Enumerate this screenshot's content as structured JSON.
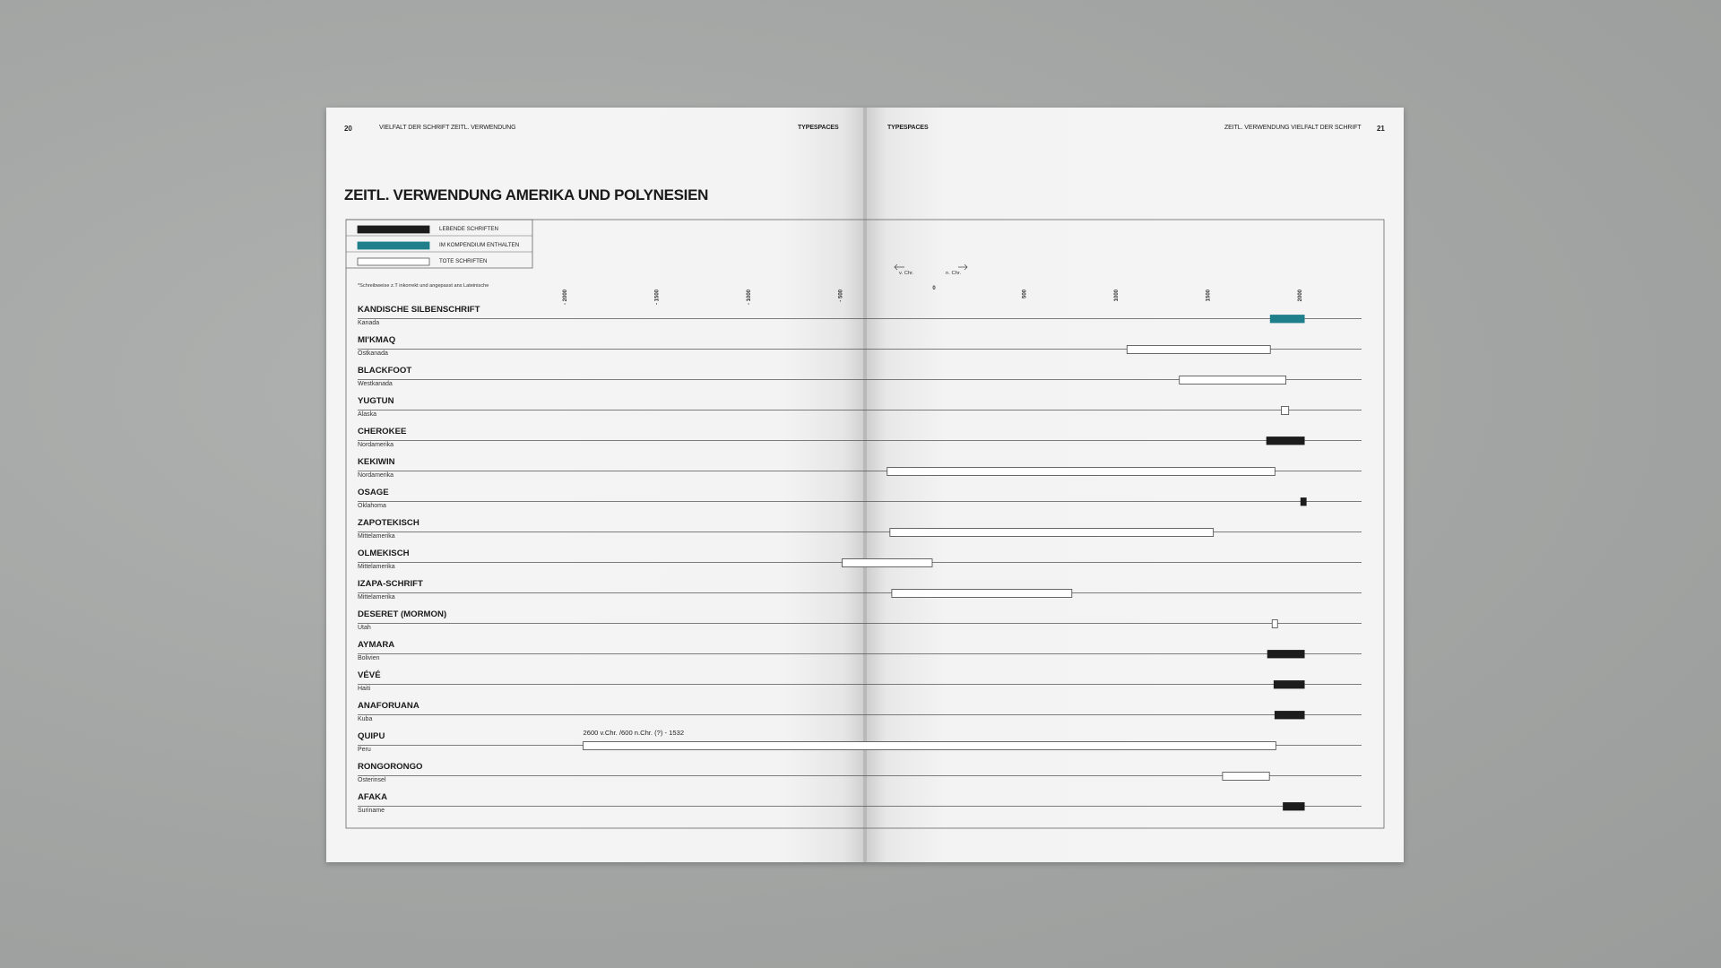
{
  "header": {
    "left_page_number": "20",
    "left_running_title": "VIELFALT DER SCHRIFT ZEITL. VERWENDUNG",
    "left_brand": "TYPESPACES",
    "right_brand": "TYPESPACES",
    "right_running_title": "ZEITL. VERWENDUNG VIELFALT DER SCHRIFT",
    "right_page_number": "21"
  },
  "page_title": "ZEITL. VERWENDUNG  AMERIKA UND POLYNESIEN",
  "colors": {
    "living": "#1c1c1c",
    "compendium": "#1f7f8a",
    "dead": "#ffffff",
    "rule": "#555555"
  },
  "chart_data": {
    "type": "timeline",
    "title": "ZEITL. VERWENDUNG  AMERIKA UND POLYNESIEN",
    "legend": [
      {
        "key": "living",
        "label": "LEBENDE SCHRIFTEN"
      },
      {
        "key": "compendium",
        "label": "IM KOMPENDIUM ENTHALTEN"
      },
      {
        "key": "dead",
        "label": "TOTE SCHRIFTEN"
      }
    ],
    "footnote": "*Schreibweise z.T inkorrekt und angepasst ans Lateinische",
    "era_labels": {
      "bc": "v. Chr.",
      "ad": "n. Chr."
    },
    "x_ticks": [
      {
        "value": -2000,
        "label": "- 2000"
      },
      {
        "value": -1500,
        "label": "- 1500"
      },
      {
        "value": -1000,
        "label": "- 1000"
      },
      {
        "value": -500,
        "label": "- 500"
      },
      {
        "value": 0,
        "label": "0"
      },
      {
        "value": 500,
        "label": "500"
      },
      {
        "value": 1000,
        "label": "1000"
      },
      {
        "value": 1500,
        "label": "1500"
      },
      {
        "value": 2000,
        "label": "2000"
      }
    ],
    "xlim": [
      -2000,
      2000
    ],
    "rows": [
      {
        "name": "KANDISCHE SILBENSCHRIFT",
        "region": "Kanada",
        "start": 1840,
        "end": 2025,
        "status": "compendium"
      },
      {
        "name": "MI'KMAQ",
        "region": "Ostkanada",
        "start": 1060,
        "end": 1840,
        "status": "dead"
      },
      {
        "name": "BLACKFOOT",
        "region": "Westkanada",
        "start": 1345,
        "end": 1925,
        "status": "dead"
      },
      {
        "name": "YUGTUN",
        "region": "Alaska",
        "start": 1900,
        "end": 1940,
        "status": "dead"
      },
      {
        "name": "CHEROKEE",
        "region": "Nordamerika",
        "start": 1820,
        "end": 2025,
        "status": "living"
      },
      {
        "name": "KEKIWIN",
        "region": "Nordamerika",
        "start": -245,
        "end": 1865,
        "status": "dead"
      },
      {
        "name": "OSAGE",
        "region": "Oklahoma",
        "start": 2006,
        "end": 2025,
        "status": "living"
      },
      {
        "name": "ZAPOTEKISCH",
        "region": "Mittelamerika",
        "start": -230,
        "end": 1530,
        "status": "dead"
      },
      {
        "name": "OLMEKISCH",
        "region": "Mittelamerika",
        "start": -490,
        "end": 0,
        "status": "dead"
      },
      {
        "name": "IZAPA-SCHRIFT",
        "region": "Mittelamerika",
        "start": -220,
        "end": 760,
        "status": "dead"
      },
      {
        "name": "DESERET (MORMON)",
        "region": "Utah",
        "start": 1850,
        "end": 1870,
        "status": "dead"
      },
      {
        "name": "AYMARA",
        "region": "Bolivien",
        "start": 1825,
        "end": 2025,
        "status": "living"
      },
      {
        "name": "VÉVÉ",
        "region": "Haiti",
        "start": 1860,
        "end": 2025,
        "status": "living"
      },
      {
        "name": "ANAFORUANA",
        "region": "Kuba",
        "start": 1865,
        "end": 2025,
        "status": "living"
      },
      {
        "name": "QUIPU",
        "region": "Peru",
        "start": -1900,
        "end": 1870,
        "status": "dead",
        "annotation": "2600 v.Chr. /600 n.Chr. (?) - 1532"
      },
      {
        "name": "RONGORONGO",
        "region": "Osterinsel",
        "start": 1580,
        "end": 1835,
        "status": "dead"
      },
      {
        "name": "AFAKA",
        "region": "Suriname",
        "start": 1910,
        "end": 2025,
        "status": "living"
      }
    ]
  }
}
